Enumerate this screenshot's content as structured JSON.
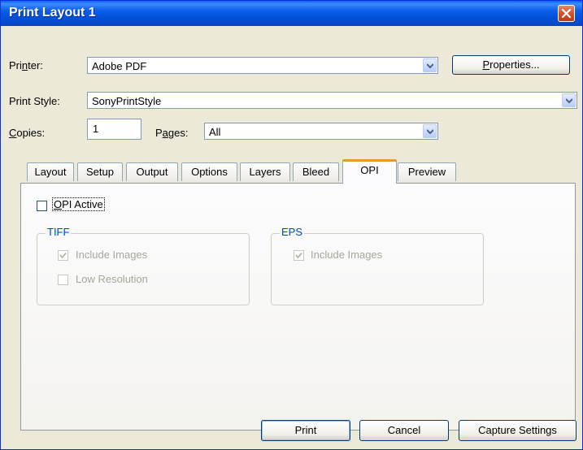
{
  "window": {
    "title": "Print Layout 1"
  },
  "printer": {
    "label_pre": "Pri",
    "label_u": "n",
    "label_post": "ter:",
    "value": "Adobe PDF",
    "properties_u": "P",
    "properties_rest": "roperties..."
  },
  "print_style": {
    "label": "Print Style:",
    "value": "SonyPrintStyle"
  },
  "copies": {
    "label_u": "C",
    "label_rest": "opies:",
    "value": "1"
  },
  "pages": {
    "label_pre": "P",
    "label_u": "a",
    "label_rest": "ges:",
    "value": "All"
  },
  "tabs": [
    {
      "label": "Layout"
    },
    {
      "label": "Setup"
    },
    {
      "label": "Output"
    },
    {
      "label": "Options"
    },
    {
      "label": "Layers"
    },
    {
      "label": "Bleed"
    },
    {
      "label": "OPI"
    },
    {
      "label": "Preview"
    }
  ],
  "active_tab": "OPI",
  "opi_active": {
    "label_u": "O",
    "label_rest": "PI Active",
    "checked": false
  },
  "tiff": {
    "title": "TIFF",
    "include_images": {
      "label": "Include Images",
      "checked": true
    },
    "low_resolution": {
      "label": "Low Resolution",
      "checked": false
    }
  },
  "eps": {
    "title": "EPS",
    "include_images": {
      "label": "Include Images",
      "checked": true
    }
  },
  "buttons": {
    "print": "Print",
    "cancel": "Cancel",
    "capture": "Capture Settings"
  },
  "colors": {
    "title_bar": "#0a5ee8",
    "group_title": "#0046d5",
    "active_tab_accent": "#e69a2b"
  }
}
